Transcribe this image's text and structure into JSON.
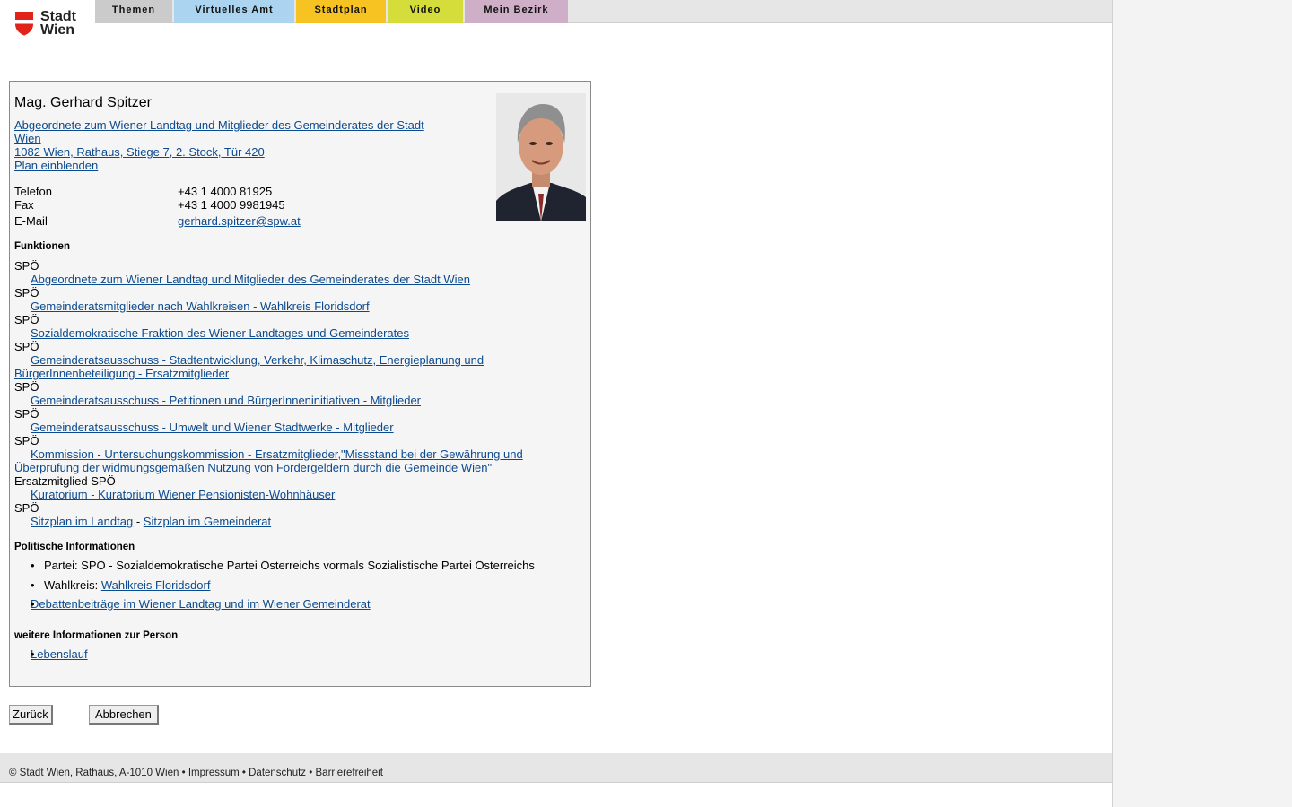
{
  "logo": {
    "line1": "Stadt",
    "line2": "Wien"
  },
  "nav": {
    "tabs": [
      {
        "label": "Themen",
        "color": "#cbcbcb"
      },
      {
        "label": "Virtuelles Amt",
        "color": "#aad4f0"
      },
      {
        "label": "Stadtplan",
        "color": "#f6c323"
      },
      {
        "label": "Video",
        "color": "#d5dd3a"
      },
      {
        "label": "Mein Bezirk",
        "color": "#cfaec8"
      }
    ]
  },
  "person": {
    "name": "Mag. Gerhard Spitzer",
    "role_link_line1": "Abgeordnete zum Wiener Landtag und Mitglieder des Gemeinderates der Stadt",
    "role_link_line2": "Wien",
    "address_link": "1082 Wien, Rathaus, Stiege 7, 2. Stock, Tür 420",
    "plan_link": "Plan einblenden"
  },
  "contact": {
    "phone_label": "Telefon",
    "phone": "+43 1 4000 81925",
    "fax_label": "Fax",
    "fax": "+43 1 4000 9981945",
    "email_label": "E-Mail",
    "email": "gerhard.spitzer@spw.at"
  },
  "functions": {
    "heading": "Funktionen",
    "items": [
      {
        "party": "SPÖ",
        "link": "Abgeordnete zum Wiener Landtag und Mitglieder des Gemeinderates der Stadt Wien"
      },
      {
        "party": "SPÖ",
        "link": "Gemeinderatsmitglieder nach Wahlkreisen - Wahlkreis Floridsdorf"
      },
      {
        "party": "SPÖ",
        "link": "Sozialdemokratische Fraktion des Wiener Landtages und Gemeinderates"
      },
      {
        "party": "SPÖ",
        "link": "Gemeinderatsausschuss - Stadtentwicklung, Verkehr, Klimaschutz, Energieplanung und BürgerInnenbeteiligung - Ersatzmitglieder"
      },
      {
        "party": "SPÖ",
        "link": "Gemeinderatsausschuss - Petitionen und BürgerInneninitiativen - Mitglieder"
      },
      {
        "party": "SPÖ",
        "link": "Gemeinderatsausschuss - Umwelt und Wiener Stadtwerke - Mitglieder"
      },
      {
        "party": "SPÖ",
        "link": "Kommission - Untersuchungskommission - Ersatzmitglieder,\"Missstand bei der Gewährung und Überprüfung der widmungsgemäßen Nutzung von Fördergeldern durch die Gemeinde Wien\""
      },
      {
        "party": "Ersatzmitglied SPÖ",
        "link": "Kuratorium - Kuratorium Wiener Pensionisten-Wohnhäuser"
      }
    ],
    "last_party": "SPÖ",
    "seat_landtag": "Sitzplan im Landtag",
    "seat_sep": "-",
    "seat_gemeinderat": "Sitzplan im Gemeinderat"
  },
  "political": {
    "heading": "Politische Informationen",
    "party_info": "Partei: SPÖ - Sozialdemokratische Partei Österreichs vormals Sozialistische Partei Österreichs",
    "wahlkreis_label": "Wahlkreis:",
    "wahlkreis_link": "Wahlkreis Floridsdorf",
    "debate_link": "Debattenbeiträge im Wiener Landtag und im Wiener Gemeinderat"
  },
  "more": {
    "heading": "weitere Informationen zur Person",
    "cv_link": "Lebenslauf"
  },
  "buttons": {
    "back": "Zurück",
    "cancel": "Abbrechen"
  },
  "footer": {
    "copyright": "© Stadt Wien, Rathaus, A-1010 Wien",
    "sep": "•",
    "impressum": "Impressum",
    "datenschutz": "Datenschutz",
    "barrierefreiheit": "Barrierefreiheit"
  }
}
